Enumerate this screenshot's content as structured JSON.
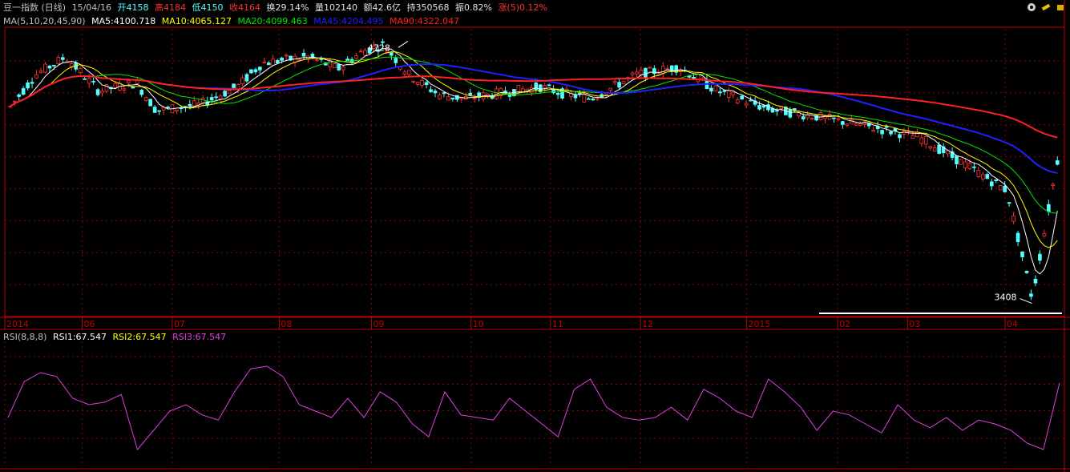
{
  "info": {
    "name": "豆一指数 (日线)",
    "date": "15/04/16",
    "open": "开4158",
    "high": "高4184",
    "low": "低4150",
    "close": "收4164",
    "turnover": "换29.14%",
    "volume": "量102140",
    "amount": "额42.6亿",
    "hold": "持350568",
    "amplitude": "振0.82%",
    "change": "涨(5)0.12%"
  },
  "ma": {
    "label": "MA(5,10,20,45,90)",
    "ma5": "MA5:4100.718",
    "ma10": "MA10:4065.127",
    "ma20": "MA20:4099.463",
    "ma45": "MA45:4204.495",
    "ma90": "MA90:4322.047"
  },
  "rsi_header": {
    "label": "RSI(8,8,8)",
    "rsi1": "RSI1:67.547",
    "rsi2": "RSI2:67.547",
    "rsi3": "RSI3:67.547"
  },
  "colors": {
    "up": "#ff3232",
    "down": "#54ffff",
    "ma5": "#ffffff",
    "ma10": "#ffff00",
    "ma20": "#00e600",
    "ma45": "#2020ff",
    "ma90": "#ff2020",
    "rsi": "#e040e0",
    "grid": "#8a0000",
    "axis": "#c00000"
  },
  "chart_data": [
    {
      "type": "candlestick",
      "title": "豆一指数 (日线)",
      "x_ticks": [
        "2014",
        "06",
        "07",
        "08",
        "09",
        "10",
        "11",
        "12",
        "2015",
        "02",
        "03",
        "04"
      ],
      "annotations": [
        {
          "label": "4728",
          "value": 4728
        },
        {
          "label": "3408",
          "value": 3408
        }
      ],
      "ylim": [
        3350,
        4790
      ],
      "series_ma": [
        {
          "name": "MA90",
          "approx": [
            4480,
            4490,
            4530,
            4520,
            4530,
            4540,
            4560,
            4570,
            4580,
            4570,
            4560,
            4550,
            4480,
            4420,
            4322
          ]
        },
        {
          "name": "MA45",
          "approx": [
            4430,
            4470,
            4530,
            4490,
            4510,
            4560,
            4650,
            4620,
            4540,
            4560,
            4530,
            4520,
            4430,
            4330,
            4204
          ]
        }
      ]
    },
    {
      "type": "line",
      "title": "RSI(8,8,8)",
      "series": [
        {
          "name": "RSI1",
          "values": [
            40,
            68,
            75,
            72,
            55,
            50,
            52,
            58,
            15,
            30,
            45,
            50,
            42,
            38,
            60,
            78,
            80,
            72,
            50,
            45,
            40,
            55,
            40,
            60,
            52,
            35,
            25,
            60,
            42,
            40,
            38,
            55,
            45,
            35,
            25,
            62,
            70,
            48,
            40,
            38,
            40,
            48,
            38,
            62,
            55,
            45,
            40,
            70,
            60,
            48,
            30,
            45,
            42,
            35,
            28,
            50,
            38,
            32,
            40,
            30,
            38,
            35,
            30,
            20,
            15,
            67
          ]
        }
      ],
      "ylim": [
        0,
        100
      ]
    }
  ]
}
